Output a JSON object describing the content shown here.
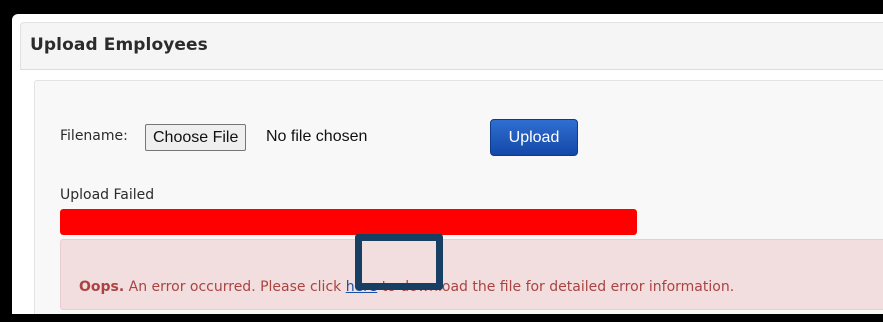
{
  "panel": {
    "title": "Upload Employees"
  },
  "form": {
    "filename_label": "Filename:",
    "choose_file_label": "Choose File",
    "no_file_text": "No file chosen",
    "upload_label": "Upload"
  },
  "status": {
    "label": "Upload Failed",
    "progress": 1.0,
    "progress_color": "#ff0000"
  },
  "alert": {
    "strong": "Oops.",
    "text_before": " An error occurred. Please click ",
    "link_text": "here",
    "text_after": " to download the file for detailed error information.",
    "background": "#f2dede",
    "text_color": "#a94442"
  },
  "colors": {
    "primary_button": "#1a56c0",
    "highlight_frame": "#163f63"
  }
}
